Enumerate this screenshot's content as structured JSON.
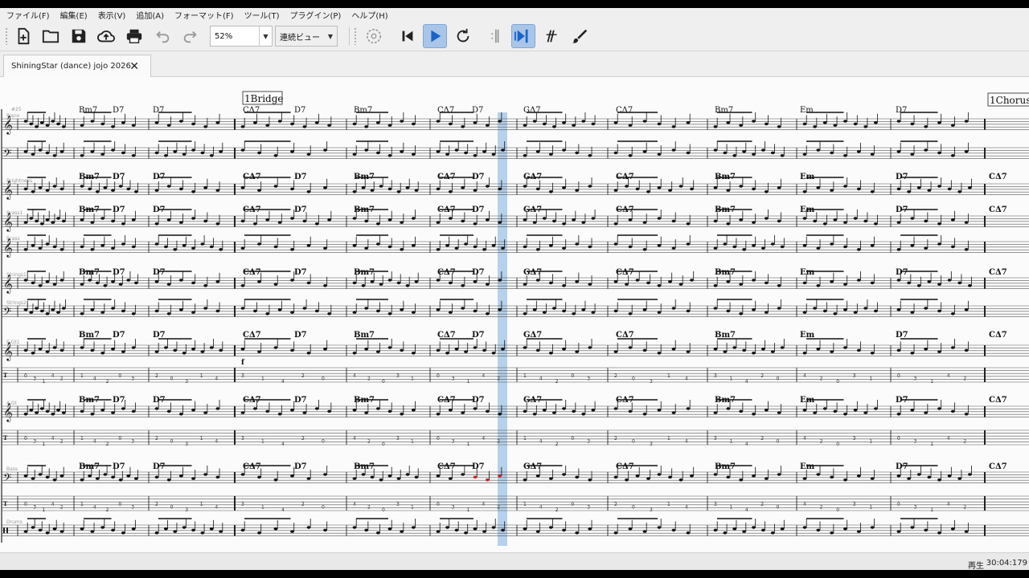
{
  "menu": [
    "ファイル(F)",
    "編集(E)",
    "表示(V)",
    "追加(A)",
    "フォーマット(F)",
    "ツール(T)",
    "プラグイン(P)",
    "ヘルプ(H)"
  ],
  "toolbar": {
    "zoom": "52%",
    "view_mode": "連続ビュー",
    "icons": [
      "new-file-icon",
      "open-folder-icon",
      "save-icon",
      "upload-cloud-icon",
      "print-icon",
      "undo-icon",
      "redo-icon",
      "metronome-icon",
      "rewind-icon",
      "play-icon",
      "loop-icon",
      "split-icon",
      "pan-icon",
      "input-icon",
      "brush-icon"
    ]
  },
  "tab": {
    "title": "ShiningStar (dance) jojo 2026"
  },
  "score": {
    "rehearsal_marks": [
      "1Bridge",
      "1Chorus"
    ],
    "chords_top": [
      "Bm7",
      "D7",
      "D7",
      "CΔ7",
      "D7",
      "Bm7",
      "CΔ7",
      "D7",
      "GΔ7",
      "CΔ7",
      "Bm7",
      "Em",
      "D7"
    ],
    "chords_repeat": [
      "Bm7",
      "D7",
      "D7",
      "CΔ7",
      "D7",
      "Bm7",
      "CΔ7",
      "D7",
      "GΔ7",
      "CΔ7",
      "Bm7",
      "Em",
      "D7",
      "CΔ7"
    ],
    "staff_labels": [
      "Piano",
      "Brightness",
      "Brass1",
      "Brass",
      "Strings1",
      "Strings2",
      "E.Gt1",
      "A.Gt",
      "Bass",
      "Drums"
    ],
    "tempo_mark": "#25",
    "dynamic": "f"
  },
  "status": {
    "state": "再生",
    "time": "30:04:179"
  },
  "colors": {
    "accent": "#a9c6e8",
    "playhead": "#9ec3e6",
    "note_red": "#d42020"
  }
}
